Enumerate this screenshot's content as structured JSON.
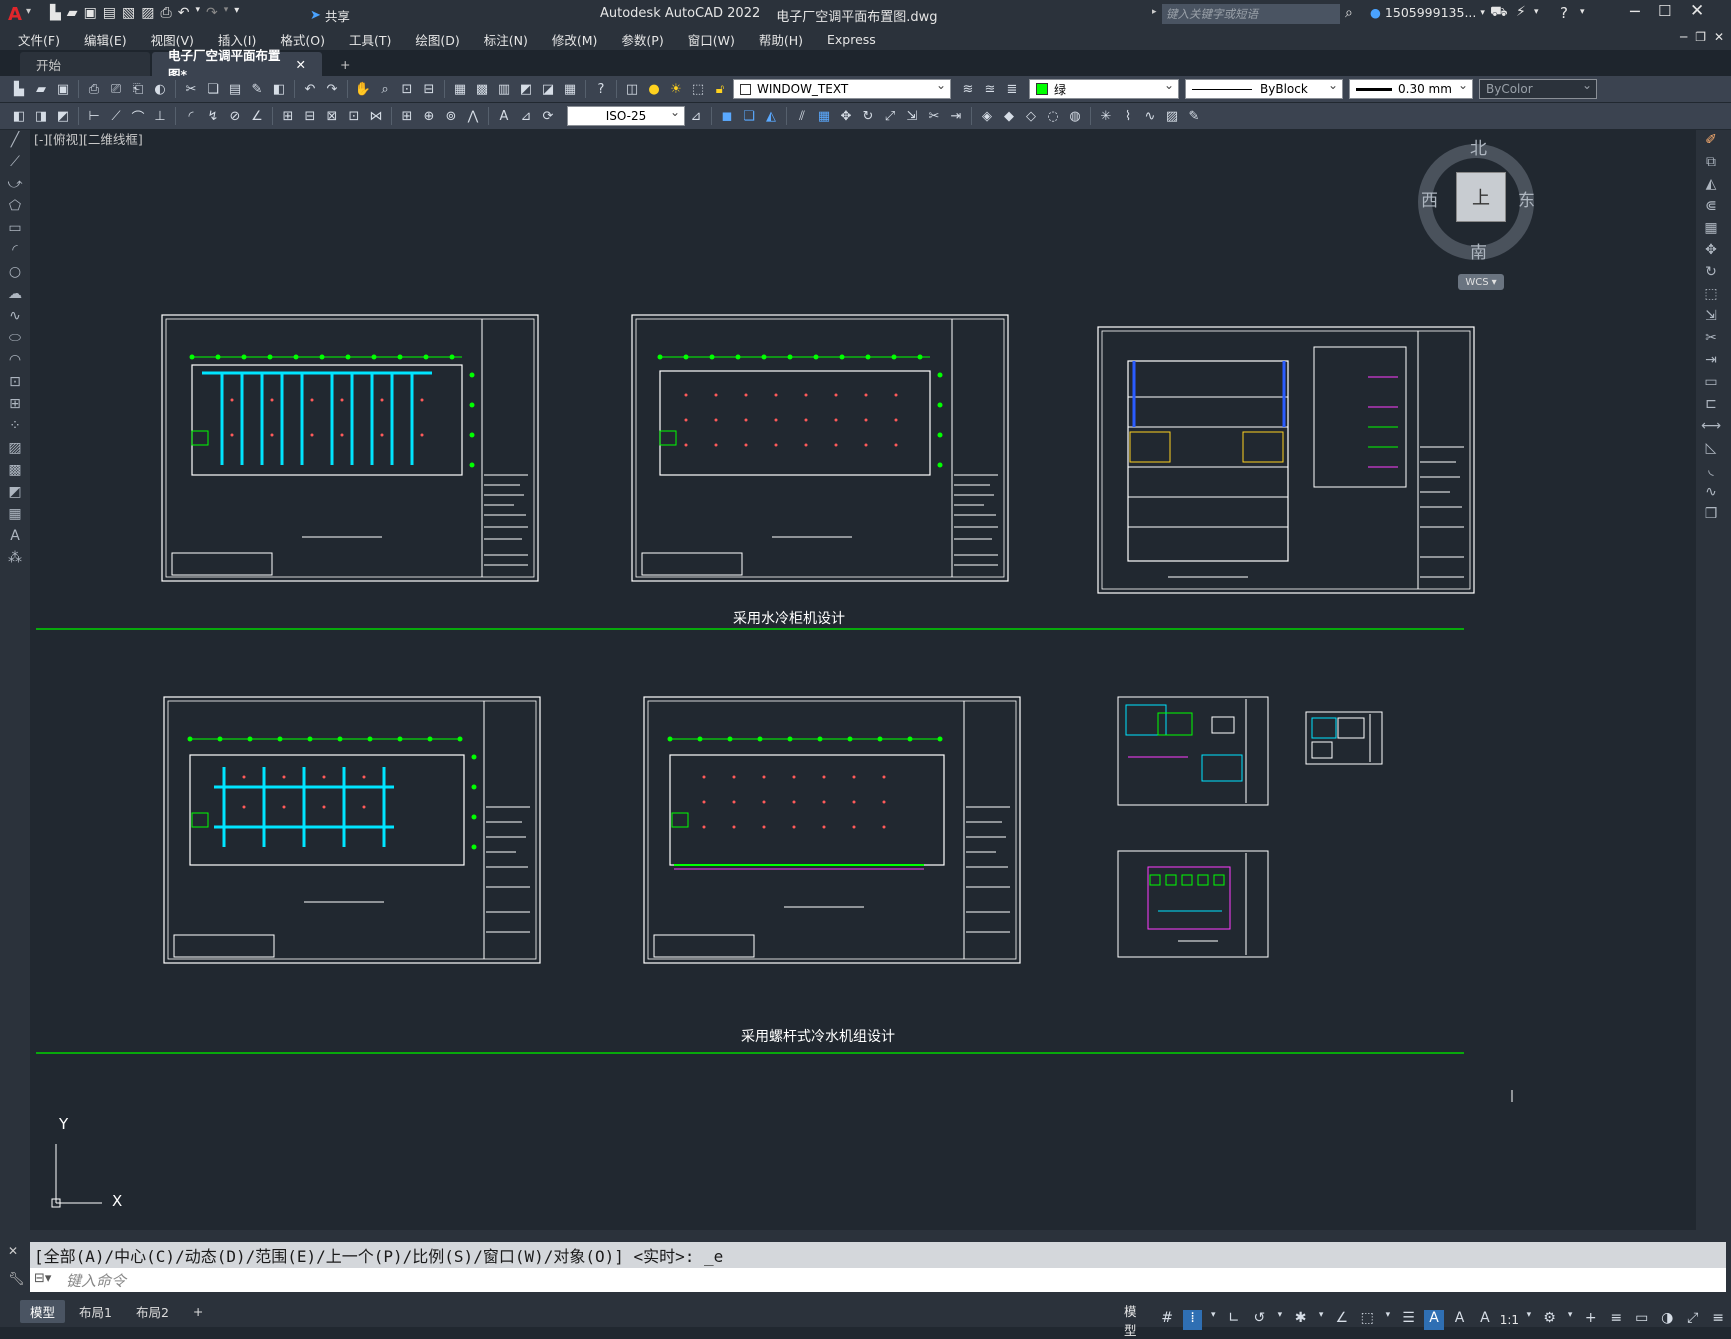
{
  "app": {
    "title": "Autodesk AutoCAD 2022",
    "filename": "电子厂空调平面布置图.dwg",
    "share_label": "共享",
    "search_placeholder": "键入关键字或短语",
    "user": "1505999135..."
  },
  "menu": [
    "文件(F)",
    "编辑(E)",
    "视图(V)",
    "插入(I)",
    "格式(O)",
    "工具(T)",
    "绘图(D)",
    "标注(N)",
    "修改(M)",
    "参数(P)",
    "窗口(W)",
    "帮助(H)",
    "Express"
  ],
  "tabs": [
    {
      "label": "开始",
      "active": false
    },
    {
      "label": "电子厂空调平面布置图*",
      "active": true
    }
  ],
  "toolbar": {
    "layer": "WINDOW_TEXT",
    "color": "绿",
    "linetype": "ByBlock",
    "lineweight": "0.30 mm",
    "plotstyle": "ByColor",
    "dimstyle": "ISO-25"
  },
  "viewport": {
    "label": "[-][俯视][二维线框]",
    "section1_label": "采用水冷柜机设计",
    "section2_label": "采用螺杆式冷水机组设计"
  },
  "viewcube": {
    "north": "北",
    "south": "南",
    "east": "东",
    "west": "西",
    "top": "上",
    "wcs": "WCS"
  },
  "ucs": {
    "x": "X",
    "y": "Y"
  },
  "command": {
    "history": "[全部(A)/中心(C)/动态(D)/范围(E)/上一个(P)/比例(S)/窗口(W)/对象(O)] <实时>: _e",
    "placeholder": "键入命令"
  },
  "status": {
    "layouts": [
      {
        "label": "模型",
        "active": true
      },
      {
        "label": "布局1",
        "active": false
      },
      {
        "label": "布局2",
        "active": false
      }
    ],
    "model_label": "模型",
    "scale": "1:1"
  },
  "colors": {
    "accent_green": "#00ff00",
    "cyan": "#00e5ff",
    "bg": "#212830"
  }
}
